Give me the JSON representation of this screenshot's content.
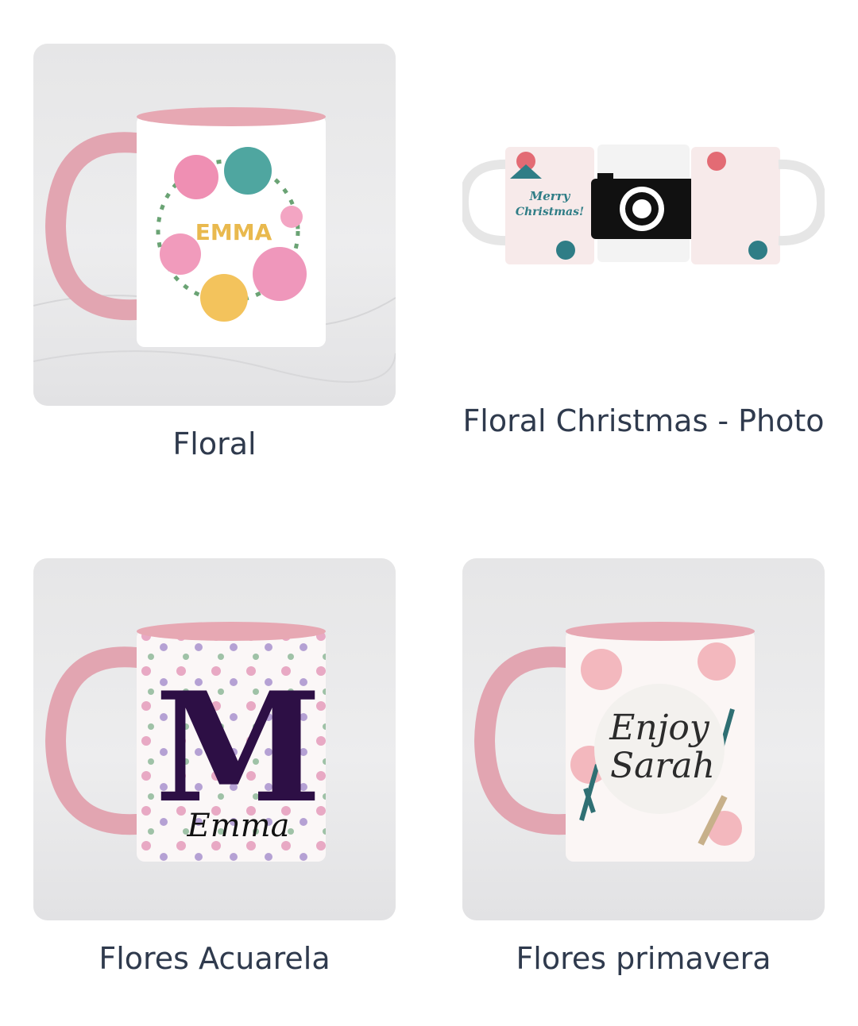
{
  "products": [
    {
      "title": "Floral",
      "mug_text": "EMMA"
    },
    {
      "title": "Floral Christmas - Photo",
      "mug_text_line1": "Merry",
      "mug_text_line2": "Christmas!"
    },
    {
      "title": "Flores Acuarela",
      "mug_letter": "M",
      "mug_text": "Emma"
    },
    {
      "title": "Flores primavera",
      "mug_text_line1": "Enjoy",
      "mug_text_line2": "Sarah"
    }
  ],
  "colors": {
    "title_text": "#2f3a4d",
    "mug_pink": "#e3a7b2",
    "card_bg": "#e9e9ea"
  }
}
